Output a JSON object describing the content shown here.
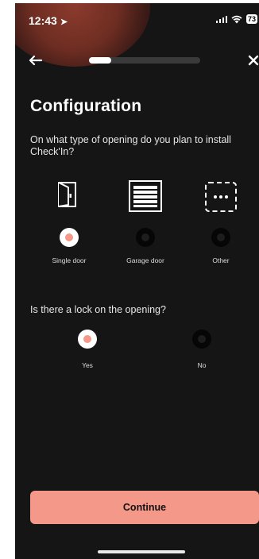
{
  "status_bar": {
    "time": "12:43",
    "battery": "73"
  },
  "nav": {
    "progress_fraction": 0.2
  },
  "page": {
    "title": "Configuration",
    "question_opening": "On what type of opening do you plan to install Check'In?",
    "question_lock": "Is there a lock on the opening?",
    "continue_label": "Continue"
  },
  "opening_options": [
    {
      "label": "Single door",
      "icon": "door-icon",
      "selected": true
    },
    {
      "label": "Garage door",
      "icon": "garage-door-icon",
      "selected": false
    },
    {
      "label": "Other",
      "icon": "more-dots-icon",
      "selected": false
    }
  ],
  "lock_options": [
    {
      "label": "Yes",
      "selected": true
    },
    {
      "label": "No",
      "selected": false
    }
  ],
  "colors": {
    "background": "#151515",
    "accent": "#f4988a",
    "text": "#ffffff"
  }
}
